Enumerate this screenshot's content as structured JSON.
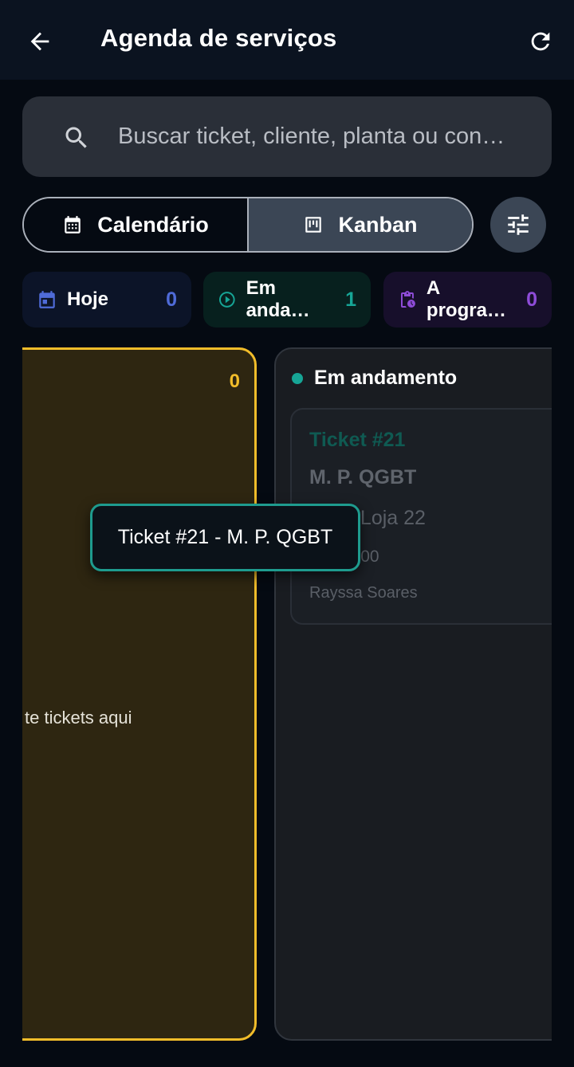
{
  "appbar": {
    "title": "Agenda de serviços",
    "back_icon": "arrow-left-icon",
    "refresh_icon": "refresh-icon"
  },
  "search": {
    "placeholder": "Buscar ticket, cliente, planta ou con…"
  },
  "view_toggle": {
    "calendar_label": "Calendário",
    "kanban_label": "Kanban",
    "selected": "Kanban"
  },
  "chips": [
    {
      "label": "Hoje",
      "count": "0",
      "color": "#4f6bd8"
    },
    {
      "label": "Em anda…",
      "count": "1",
      "color": "#16a596"
    },
    {
      "label": "A progra…",
      "count": "0",
      "color": "#8e4cd8"
    }
  ],
  "board": {
    "yellow_column": {
      "count": "0",
      "empty_text": "te tickets aqui",
      "accent": "#f2bd2a"
    },
    "progress_column": {
      "title": "Em andamento",
      "accent": "#16a596",
      "card": {
        "ticket": "Ticket #21",
        "title": "M. P. QGBT",
        "location": "te 1 - Loja 22",
        "date": "/07 08:00",
        "user": "Rayssa Soares"
      }
    }
  },
  "drag_tooltip": {
    "text": "Ticket #21 - M. P. QGBT"
  }
}
